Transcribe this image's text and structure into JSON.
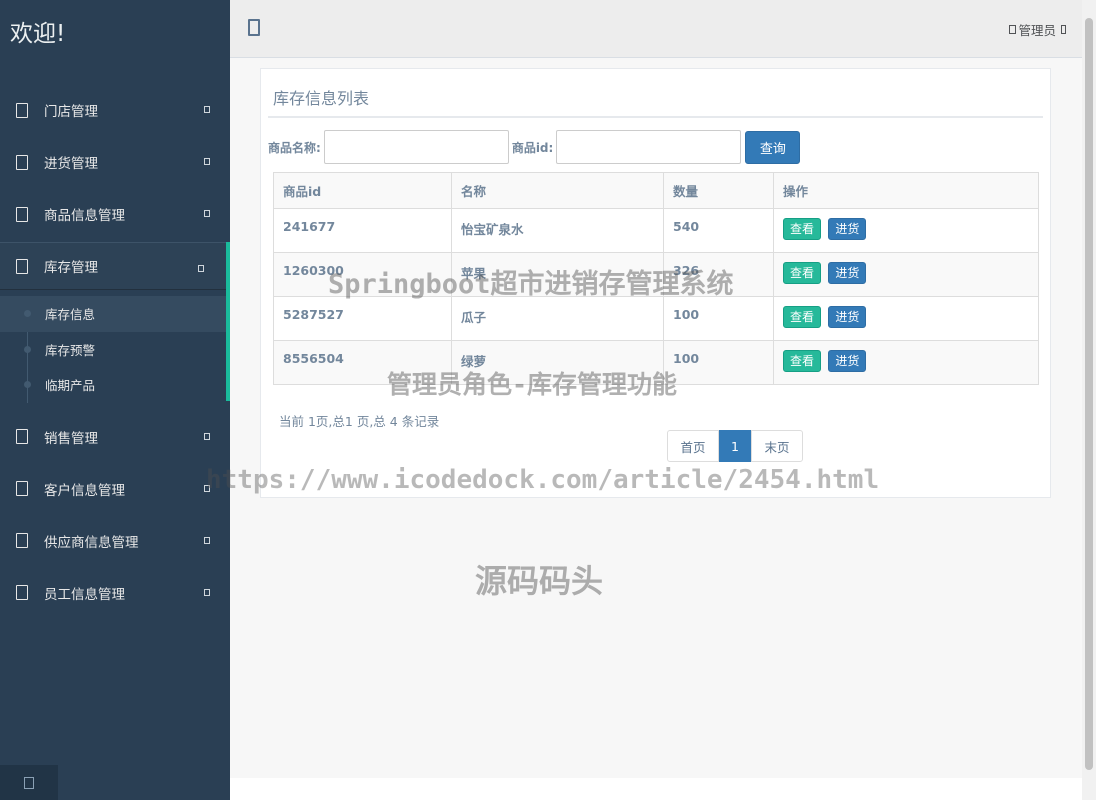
{
  "brand": "欢迎!",
  "sidebar": {
    "items": [
      {
        "label": "门店管理"
      },
      {
        "label": "进货管理"
      },
      {
        "label": "商品信息管理"
      },
      {
        "label": "库存管理"
      },
      {
        "label": "销售管理"
      },
      {
        "label": "客户信息管理"
      },
      {
        "label": "供应商信息管理"
      },
      {
        "label": "员工信息管理"
      }
    ],
    "submenu": [
      {
        "label": "库存信息"
      },
      {
        "label": "库存预警"
      },
      {
        "label": "临期产品"
      }
    ]
  },
  "topnav": {
    "user": "管理员"
  },
  "panel": {
    "title": "库存信息列表"
  },
  "search": {
    "name_label": "商品名称:",
    "id_label": "商品id:",
    "query_button": "查询"
  },
  "table": {
    "headers": [
      "商品id",
      "名称",
      "数量",
      "操作"
    ],
    "rows": [
      {
        "id": "241677",
        "name": "怡宝矿泉水",
        "qty": "540"
      },
      {
        "id": "1260300",
        "name": "苹果",
        "qty": "326"
      },
      {
        "id": "5287527",
        "name": "瓜子",
        "qty": "100"
      },
      {
        "id": "8556504",
        "name": "绿萝",
        "qty": "100"
      }
    ],
    "view_label": "查看",
    "stock_label": "进货"
  },
  "pagination": {
    "info": "当前 1页,总1 页,总 4 条记录",
    "first": "首页",
    "current": "1",
    "last": "末页"
  },
  "watermarks": {
    "line1": "Springboot超市进销存管理系统",
    "line2": "管理员角色-库存管理功能",
    "line3": "https://www.icodedock.com/article/2454.html",
    "line4": "源码码头"
  },
  "colors": {
    "sidebar": "#2a3f54",
    "accent_bar": "#1abb9c",
    "primary": "#337ab7",
    "success": "#26b99a"
  }
}
